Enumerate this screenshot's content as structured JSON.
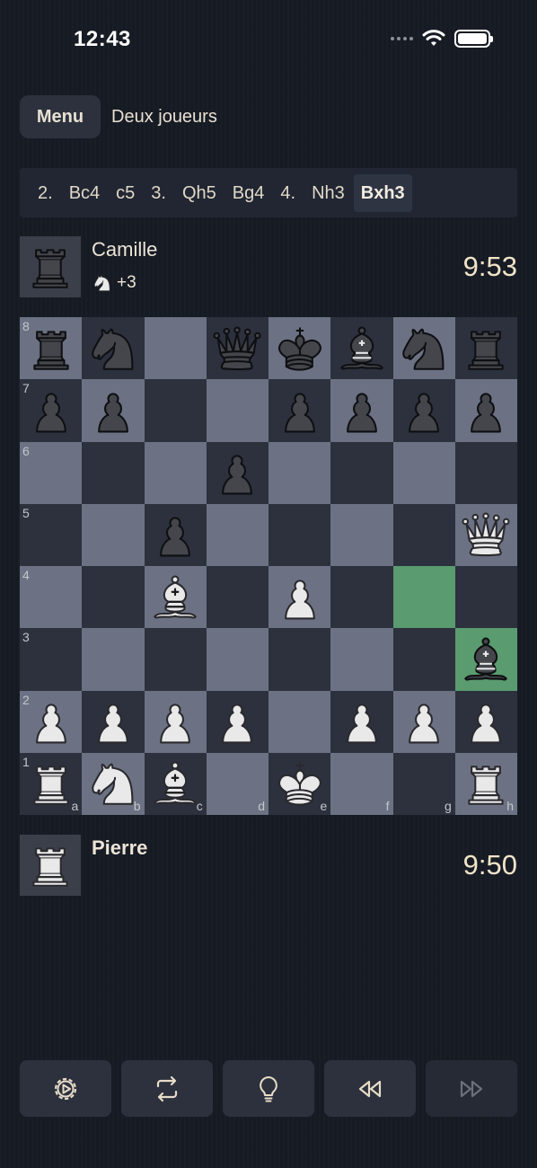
{
  "status_bar": {
    "time": "12:43"
  },
  "header": {
    "menu_label": "Menu",
    "mode_label": "Deux joueurs"
  },
  "moves": [
    {
      "text": "2.",
      "num": true,
      "active": false
    },
    {
      "text": "Bc4",
      "num": false,
      "active": false
    },
    {
      "text": "c5",
      "num": false,
      "active": false
    },
    {
      "text": "3.",
      "num": true,
      "active": false
    },
    {
      "text": "Qh5",
      "num": false,
      "active": false
    },
    {
      "text": "Bg4",
      "num": false,
      "active": false
    },
    {
      "text": "4.",
      "num": true,
      "active": false
    },
    {
      "text": "Nh3",
      "num": false,
      "active": false
    },
    {
      "text": "Bxh3",
      "num": false,
      "active": true
    }
  ],
  "top_player": {
    "name": "Camille",
    "avatar_piece": "rook",
    "captured_piece": "knight",
    "material": "+3",
    "clock": "9:53"
  },
  "bottom_player": {
    "name": "Pierre",
    "avatar_piece": "rook",
    "clock": "9:50"
  },
  "board": {
    "rows": [
      [
        "r",
        "n",
        "",
        "q",
        "k",
        "b",
        "n",
        "r"
      ],
      [
        "p",
        "p",
        "",
        "",
        "p",
        "p",
        "p",
        "p"
      ],
      [
        "",
        "",
        "",
        "p",
        "",
        "",
        "",
        ""
      ],
      [
        "",
        "",
        "p",
        "",
        "",
        "",
        "",
        "Q"
      ],
      [
        "",
        "",
        "B",
        "",
        "P",
        "",
        "",
        ""
      ],
      [
        "",
        "",
        "",
        "",
        "",
        "",
        "",
        "b"
      ],
      [
        "P",
        "P",
        "P",
        "P",
        "",
        "P",
        "P",
        "P"
      ],
      [
        "R",
        "N",
        "B",
        "",
        "K",
        "",
        "",
        "R"
      ]
    ],
    "highlights": [
      "g4",
      "h3"
    ],
    "ranks": [
      "8",
      "7",
      "6",
      "5",
      "4",
      "3",
      "2",
      "1"
    ],
    "files": [
      "a",
      "b",
      "c",
      "d",
      "e",
      "f",
      "g",
      "h"
    ]
  },
  "toolbar": [
    {
      "icon": "settings-icon",
      "enabled": true
    },
    {
      "icon": "flip-board-icon",
      "enabled": true
    },
    {
      "icon": "hint-bulb-icon",
      "enabled": true
    },
    {
      "icon": "rewind-icon",
      "enabled": true
    },
    {
      "icon": "fast-forward-icon",
      "enabled": false
    }
  ],
  "colors": {
    "background": "#161b24",
    "light_square": "#6c7283",
    "dark_square": "#2c313d",
    "highlight": "#5a9b70",
    "clock_text": "#f0e4c8"
  }
}
